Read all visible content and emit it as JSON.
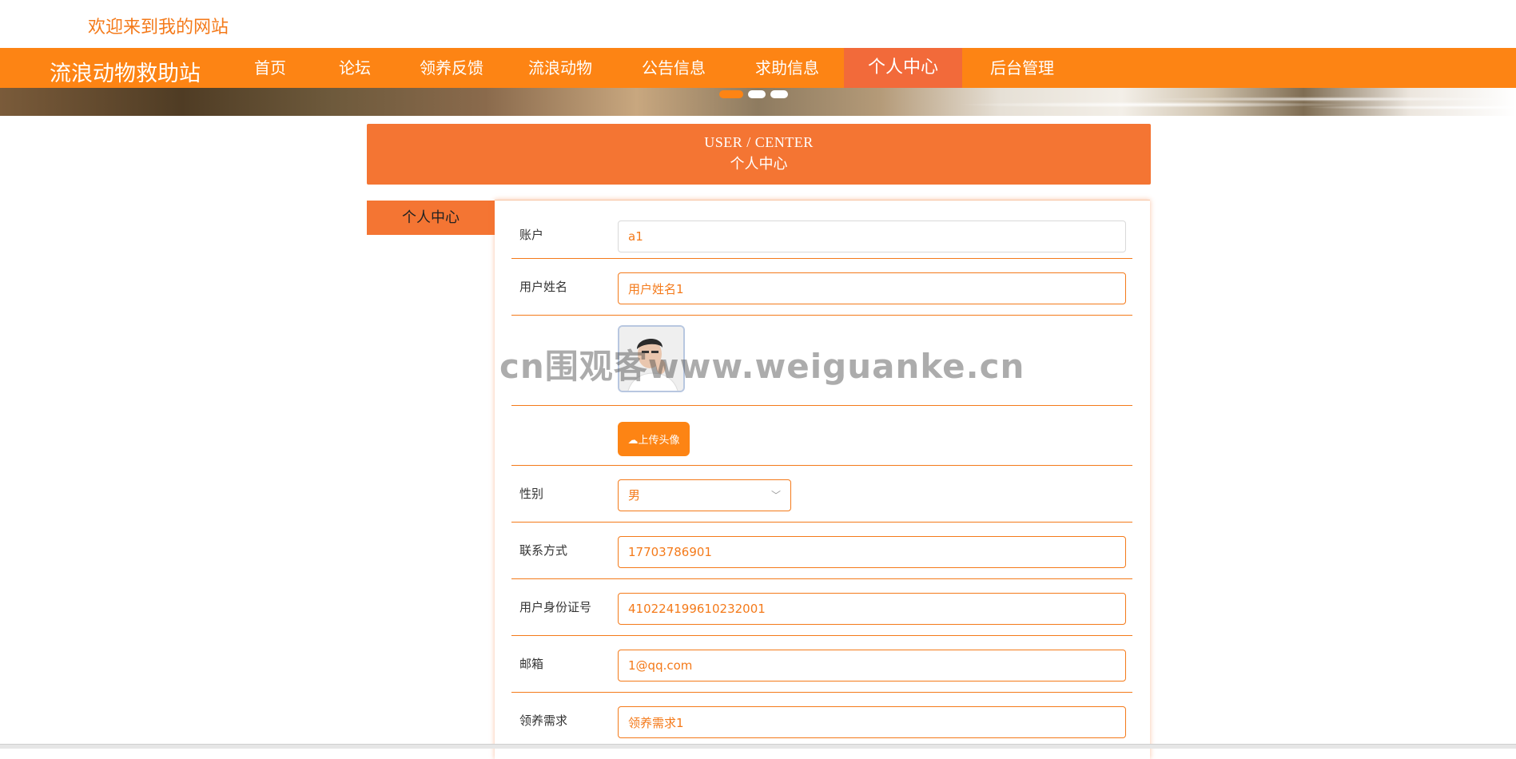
{
  "header": {
    "welcome": "欢迎来到我的网站"
  },
  "nav": {
    "brand": "流浪动物救助站",
    "items": [
      {
        "label": "首页"
      },
      {
        "label": "论坛"
      },
      {
        "label": "领养反馈"
      },
      {
        "label": "流浪动物"
      },
      {
        "label": "公告信息"
      },
      {
        "label": "求助信息"
      },
      {
        "label": "个人中心",
        "active": true
      },
      {
        "label": "后台管理"
      }
    ]
  },
  "center_header": {
    "title_en": "USER / CENTER",
    "title_cn": "个人中心"
  },
  "sidebar": {
    "tab_label": "个人中心"
  },
  "form": {
    "account": {
      "label": "账户",
      "value": "a1"
    },
    "username": {
      "label": "用户姓名",
      "value": "用户姓名1"
    },
    "upload_label": "上传头像",
    "gender": {
      "label": "性别",
      "value": "男"
    },
    "phone": {
      "label": "联系方式",
      "value": "17703786901"
    },
    "id_number": {
      "label": "用户身份证号",
      "value": "410224199610232001"
    },
    "email": {
      "label": "邮箱",
      "value": "1@qq.com"
    },
    "adopt_need": {
      "label": "领养需求",
      "value": "领养需求1"
    }
  },
  "watermark": "cn围观客www.weiguanke.cn",
  "colors": {
    "brand_orange": "#fd8414",
    "accent": "#f47533",
    "active_nav": "#f26a3a"
  }
}
